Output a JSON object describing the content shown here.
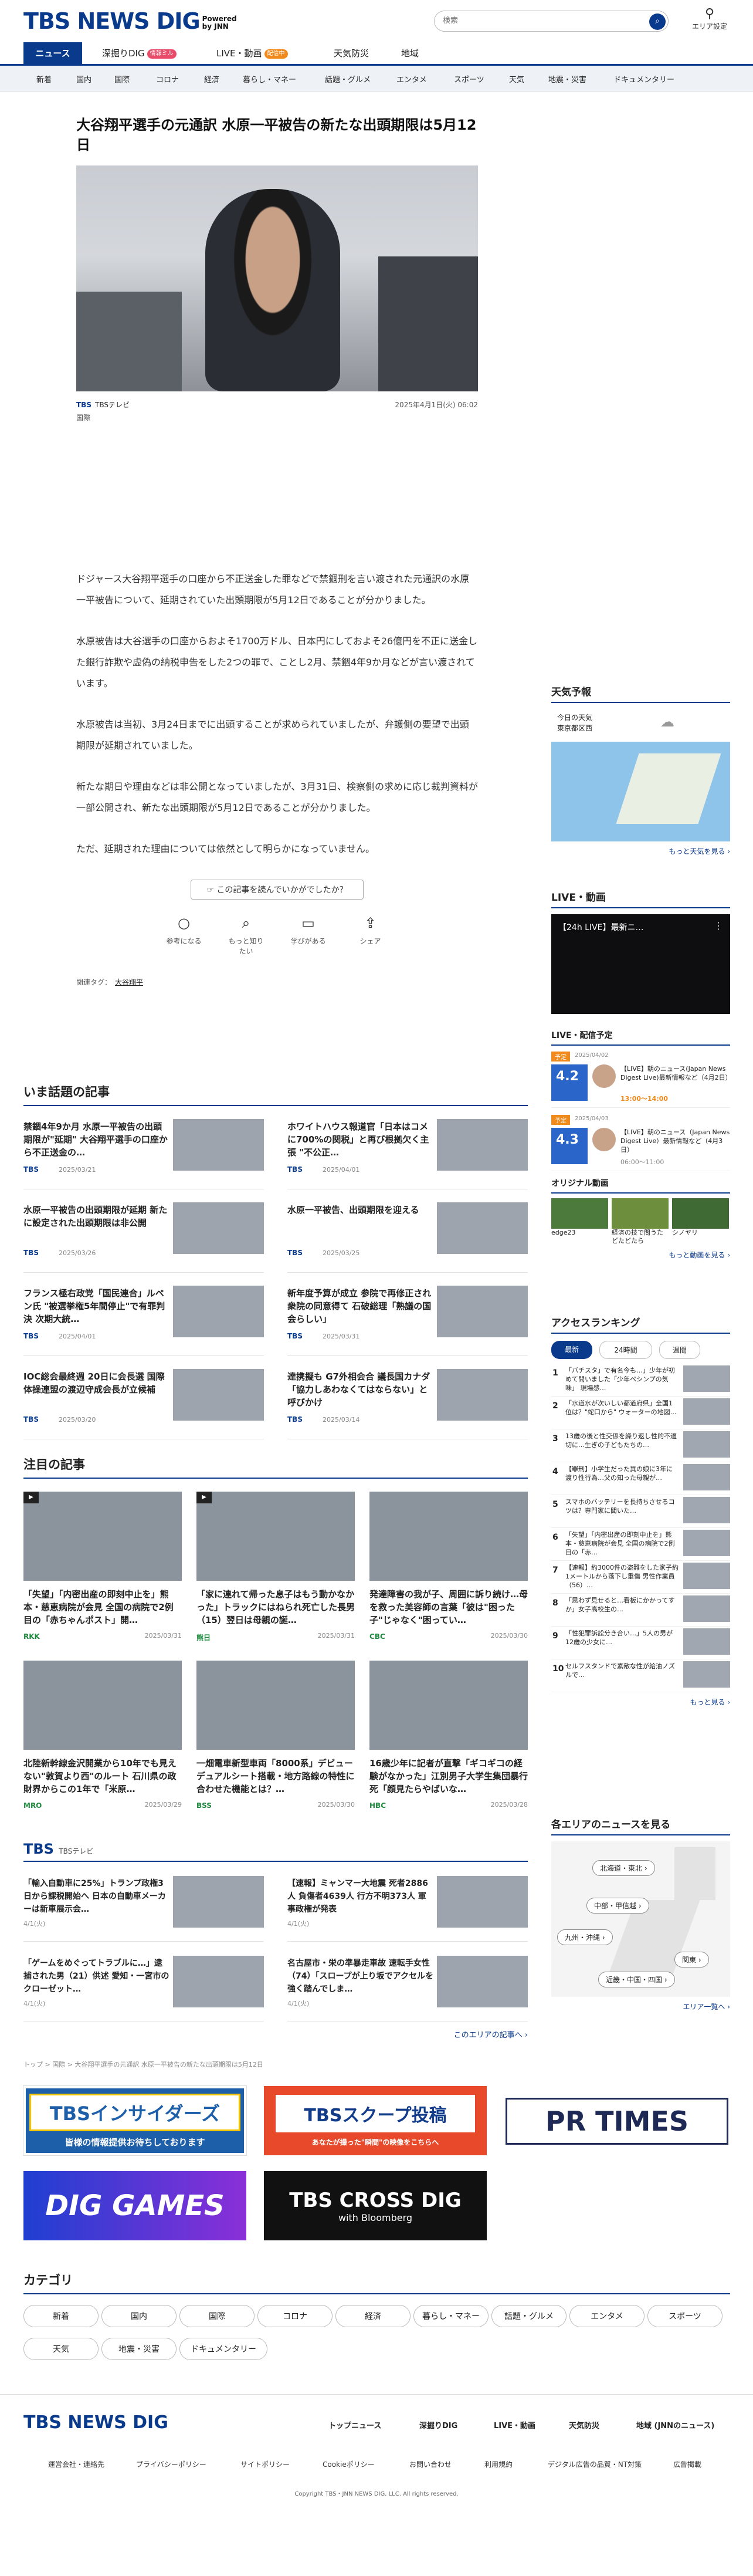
{
  "brand": {
    "name": "TBS NEWS DIG",
    "powered_line1": "Powered",
    "powered_line2": "by JNN"
  },
  "search": {
    "placeholder": "検索"
  },
  "area_setting": "エリア設定",
  "tabs": [
    {
      "label": "ニュース",
      "badge": ""
    },
    {
      "label": "深掘りDIG",
      "badge": "情報ミル"
    },
    {
      "label": "LIVE・動画",
      "badge": "配信中"
    },
    {
      "label": "天気防災",
      "badge": ""
    },
    {
      "label": "地域",
      "badge": ""
    }
  ],
  "categories": [
    "新着",
    "国内",
    "国際",
    "コロナ",
    "経済",
    "暮らし・マネー",
    "話題・グルメ",
    "エンタメ",
    "スポーツ",
    "天気",
    "地震・災害",
    "ドキュメンタリー"
  ],
  "article": {
    "title": "大谷翔平選手の元通訳 水原一平被告の新たな出頭期限は5月12日",
    "source_logo": "TBS",
    "source": "TBSテレビ",
    "date": "2025年4月1日(火) 06:02",
    "genre": "国際",
    "paragraphs": [
      "ドジャース大谷翔平選手の口座から不正送金した罪などで禁錮刑を言い渡された元通訳の水原一平被告について、延期されていた出頭期限が5月12日であることが分かりました。",
      "水原被告は大谷選手の口座からおよそ1700万ドル、日本円にしておよそ26億円を不正に送金した銀行詐欺や虚偽の納税申告をした2つの罪で、ことし2月、禁錮4年9か月などが言い渡されています。",
      "水原被告は当初、3月24日までに出頭することが求められていましたが、弁護側の要望で出頭期限が延期されていました。",
      "新たな期日や理由などは非公開となっていましたが、3月31日、検察側の求めに応じ裁判資料が一部公開され、新たな出頭期限が5月12日であることが分かりました。",
      "ただ、延期された理由については依然として明らかになっていません。"
    ],
    "feedback_prompt": "この記事を読んでいかがでしたか？",
    "reactions": [
      "参考になる",
      "もっと知りたい",
      "学びがある",
      "シェア"
    ],
    "tags_label": "関連タグ：",
    "tag": "大谷翔平"
  },
  "trending": {
    "heading": "いま話題の記事",
    "items": [
      {
        "title": "禁錮4年9か月 水原一平被告の出頭期限が\"延期\" 大谷翔平選手の口座から不正送金の…",
        "source": "TBS",
        "date": "2025/03/21"
      },
      {
        "title": "ホワイトハウス報道官「日本はコメに700%の関税」と再び根拠欠く主張 \"不公正…",
        "source": "TBS",
        "date": "2025/04/01"
      },
      {
        "title": "水原一平被告の出頭期限が延期 新たに設定された出頭期限は非公開",
        "source": "TBS",
        "date": "2025/03/26"
      },
      {
        "title": "水原一平被告、出頭期限を迎える",
        "source": "TBS",
        "date": "2025/03/25"
      },
      {
        "title": "フランス極右政党「国民連合」ルペン氏 \"被選挙権5年間停止\"で有罪判決 次期大統…",
        "source": "TBS",
        "date": "2025/04/01"
      },
      {
        "title": "新年度予算が成立 参院で再修正され衆院の同意得て 石破総理「熟議の国会らしい」",
        "source": "TBS",
        "date": "2025/03/31"
      },
      {
        "title": "IOC総会最終週 20日に会長選 国際体操連盟の渡辺守成会長が立候補",
        "source": "TBS",
        "date": "2025/03/20"
      },
      {
        "title": "達携擬も G7外相会合 議長国カナダ「協力しあわなくてはならない」と呼びかけ",
        "source": "TBS",
        "date": "2025/03/14"
      }
    ]
  },
  "featured": {
    "heading": "注目の記事",
    "items": [
      {
        "title": "「失望」「内密出産の即刻中止を」熊本・慈恵病院が会見 全国の病院で2例目の「赤ちゃんポスト」開…",
        "source": "RKK",
        "date": "2025/03/31"
      },
      {
        "title": "「家に連れて帰った息子はもう動かなかった」トラックにはねられ死亡した長男（15）翌日は母親の誕…",
        "source": "熊日",
        "date": "2025/03/31"
      },
      {
        "title": "発達障害の我が子、周囲に訴り続け…母を救った美容師の言葉「彼は\"困った子\"じゃなく\"困ってい…",
        "source": "CBC",
        "date": "2025/03/30"
      },
      {
        "title": "北陸新幹線金沢開業から10年でも見えない\"敦賀より西\"のルート 石川県の政財界からこの1年で「米原…",
        "source": "MRO",
        "date": "2025/03/29"
      },
      {
        "title": "一畑電車新型車両「8000系」デビュー デュアルシート搭載・地方路線の特性に合わせた機能とは？…",
        "source": "BSS",
        "date": "2025/03/30"
      },
      {
        "title": "16歳少年に記者が直撃「ギコギコの経験がなかった」江別男子大学生集団暴行死「顔見たらやばいな…",
        "source": "HBC",
        "date": "2025/03/28"
      }
    ]
  },
  "tbs_section": {
    "heading": "TBS",
    "sub": "TBSテレビ",
    "items": [
      {
        "title": "「輸入自動車に25%」トランプ政権3日から課税開始へ 日本の自動車メーカーは新車展示会…",
        "date": "4/1(火)"
      },
      {
        "title": "【速報】ミャンマー大地震 死者2886人 負傷者4639人 行方不明373人 軍事政権が発表",
        "date": "4/1(火)"
      },
      {
        "title": "「ゲームをめぐってトラブルに…」逮捕された男（21）供述 愛知・一宮市のクローゼット…",
        "date": "4/1(火)"
      },
      {
        "title": "名古屋市・栄の準暴走車故 速転手女性（74）「スロープが上り坂でアクセルを強く踏んでしま…",
        "date": "4/1(火)"
      }
    ],
    "more": "このエリアの記事へ ›"
  },
  "breadcrumb": "トップ > 国際 > 大谷翔平選手の元通訳 水原一平被告の新たな出頭期限は5月12日",
  "banners": {
    "insiders": "TBSインサイダーズ",
    "insiders_sub": "皆様の情報提供お待ちしております",
    "scoop": "TBSスクープ投稿",
    "scoop_sub": "あなたが撮った\"瞬間\"の映像をこちらへ",
    "prtimes": "PR TIMES",
    "diggames": "DIG GAMES",
    "crossdig": "TBS CROSS DIG",
    "crossdig_sub": "with Bloomberg"
  },
  "category_section": {
    "heading": "カテゴリ"
  },
  "sidebar": {
    "weather": {
      "heading": "天気予報",
      "today": "今日の天気",
      "region": "東京都区西",
      "more": "もっと天気を見る ›"
    },
    "live": {
      "heading": "LIVE・動画",
      "player_title": "【24h LIVE】最新ニ…",
      "schedule_heading": "LIVE・配信予定",
      "items": [
        {
          "tag": "予定",
          "date": "2025/04/02",
          "day": "4.2",
          "title": "【LIVE】朝のニュース(Japan News Digest Live)最新情報など（4月2日）",
          "time": "13:00〜14:00"
        },
        {
          "tag": "予定",
          "date": "2025/04/03",
          "day": "4.3",
          "title": "【LIVE】朝のニュース（Japan News Digest Live）最新情報など（4月3日）",
          "time": "06:00〜11:00"
        }
      ],
      "original_heading": "オリジナル動画",
      "originals": [
        "edge23",
        "経済の技で問うたどたどたら",
        "シノヤリ"
      ],
      "more": "もっと動画を見る ›"
    },
    "ranking": {
      "heading": "アクセスランキング",
      "tabs": [
        "最新",
        "24時間",
        "週間"
      ],
      "items": [
        "「バチスタ」で有名今も…」少年が初めて問いました「少年ペシンプの気味」 現場感…",
        "「水道水が次いしい都道府県」全国1位は？\"蛇口から\" ウォーターの地図…",
        "13歳の後と性交係を繰り返し性的不適切に…生ぎの子どもたちの…",
        "【罪刑】小学生だった異の娘に3年に渡り性行為…父の知った母親が…",
        "スマホのバッテリーを長持ちさせるコツは？専門家に聞いた…",
        "「失望」「内密出産の即刻中止を」熊本・慈恵病院が会見 全国の病院で2例目の「赤…",
        "【速報】約3000件の盗難をした家子約1メートルから落下し重傷 男性作業員（56）…",
        "「思わず見せると…看板にかかってすか」女子高校生の…",
        "「性犯罪訴訟分き合い…」5人の男が12歳の少女に…",
        "セルフスタンドで素敵な性が給油ノズルで…"
      ],
      "more": "もっと見る ›"
    },
    "areas": {
      "heading": "各エリアのニュースを見る",
      "buttons": [
        "北海道・東北 ›",
        "中部・甲信越 ›",
        "九州・沖縄 ›",
        "関東 ›",
        "近畿・中国・四国 ›"
      ],
      "more": "エリア一覧へ ›"
    }
  },
  "footer": {
    "nav": [
      "トップニュース",
      "深掘りDIG",
      "LIVE・動画",
      "天気防災",
      "地域 (JNNのニュース)"
    ],
    "links": [
      "運営会社・連絡先",
      "プライバシーポリシー",
      "サイトポリシー",
      "Cookieポリシー",
      "お問い合わせ",
      "利用規約",
      "デジタル広告の品質・NT対策",
      "広告掲載"
    ],
    "copyright": "Copyright TBS・JNN NEWS DIG, LLC. All rights reserved."
  }
}
